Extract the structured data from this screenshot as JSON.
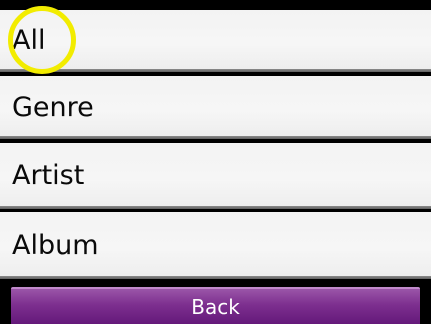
{
  "menu": {
    "items": [
      {
        "label": "All"
      },
      {
        "label": "Genre"
      },
      {
        "label": "Artist"
      },
      {
        "label": "Album"
      }
    ],
    "highlighted_item": "All",
    "highlight_color": "#f2ec00"
  },
  "footer": {
    "back_label": "Back",
    "back_color": "#7d2f8f"
  }
}
